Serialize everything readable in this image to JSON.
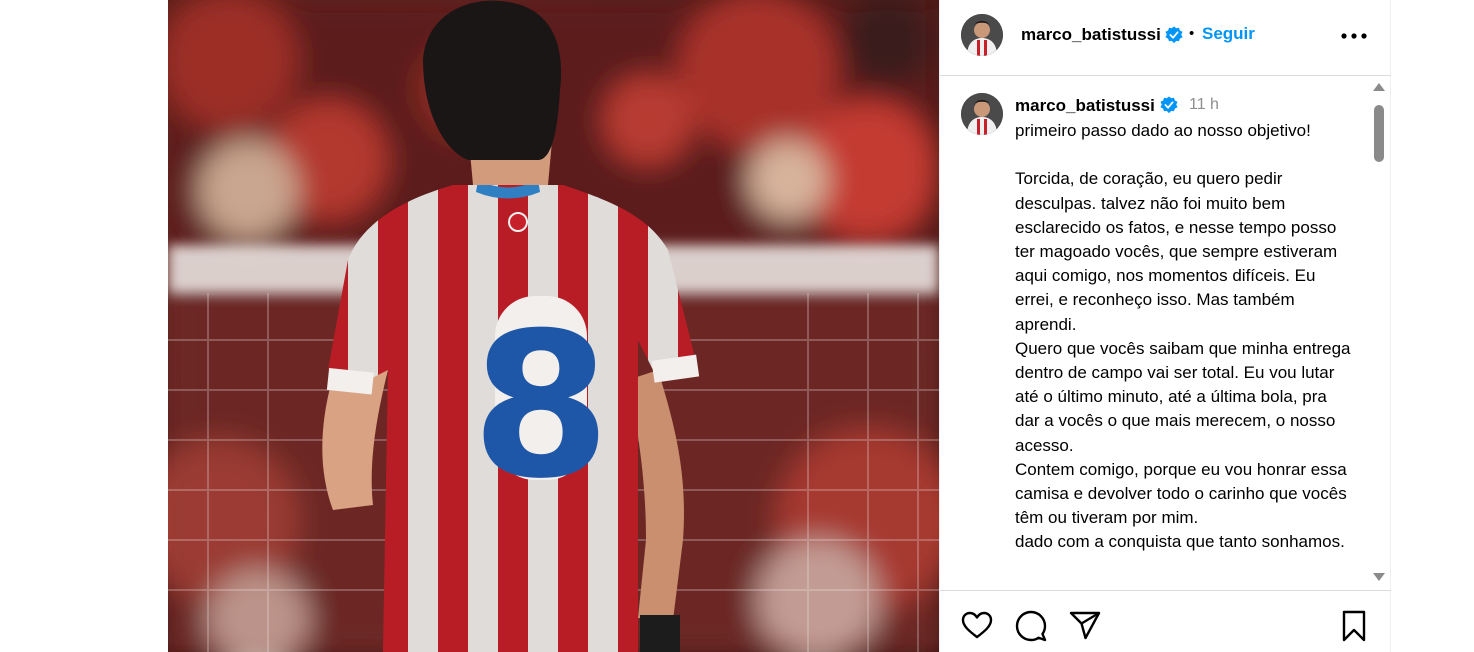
{
  "post": {
    "username": "marco_batistussi",
    "separator": "•",
    "follow_label": "Seguir",
    "more_icon": "more-horizontal-icon",
    "verified_icon": "verified-badge-icon"
  },
  "photo": {
    "jersey_number": "8",
    "colors": {
      "stripe_red": "#c8202a",
      "stripe_white": "#f2efec",
      "number_blue": "#1f57a8"
    }
  },
  "comment": {
    "username": "marco_batistussi",
    "time": "11 h",
    "caption": "primeiro passo dado ao nosso objetivo!\n\nTorcida, de coração, eu quero pedir desculpas. talvez não foi muito bem esclarecido os fatos, e nesse tempo posso ter magoado vocês, que sempre estiveram aqui comigo, nos momentos difíceis. Eu errei, e reconheço isso. Mas também aprendi.\nQuero que vocês saibam que minha entrega dentro de campo vai ser total. Eu vou lutar até o último minuto, até a última bola, pra dar a vocês o que mais merecem, o nosso acesso.\nContem comigo, porque eu vou honrar essa camisa e devolver todo o carinho que vocês têm ou tiveram por mim.\ndado com a conquista que tanto sonhamos."
  },
  "actions": {
    "like": "heart-icon",
    "comment": "comment-bubble-icon",
    "share": "send-paper-plane-icon",
    "save": "bookmark-icon"
  },
  "colors": {
    "accent": "#0095f6",
    "muted": "#8e8e8e",
    "border": "#dbdbdb"
  }
}
